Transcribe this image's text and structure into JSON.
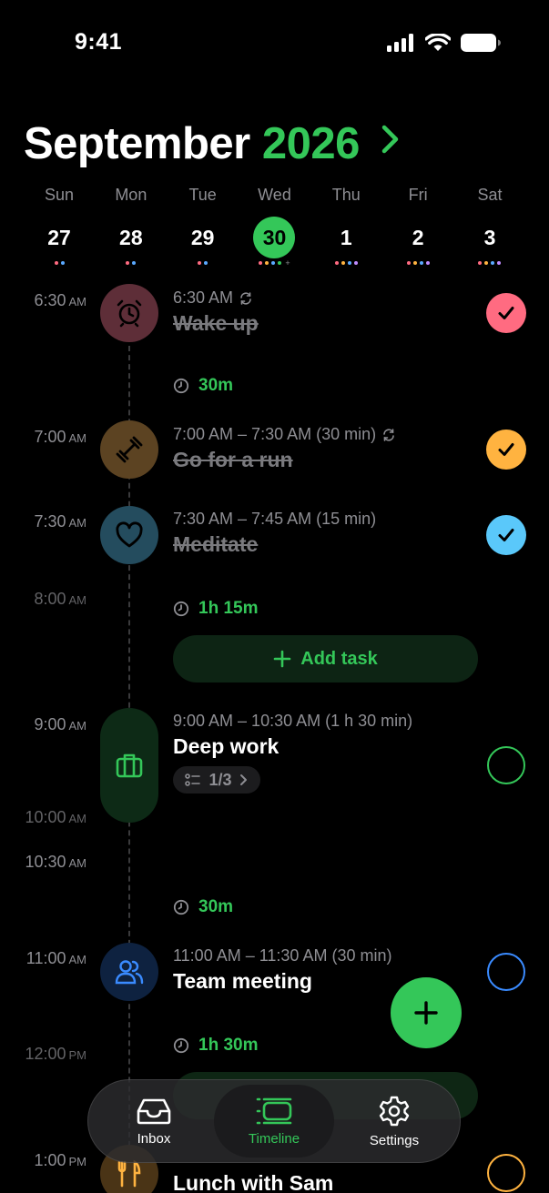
{
  "status_bar": {
    "time": "9:41"
  },
  "header": {
    "month": "September",
    "year": "2026"
  },
  "week": [
    {
      "dow": "Sun",
      "date": "27",
      "dots": [
        "#ff6b81",
        "#5aa9ff"
      ]
    },
    {
      "dow": "Mon",
      "date": "28",
      "dots": [
        "#ff6b81",
        "#5aa9ff"
      ]
    },
    {
      "dow": "Tue",
      "date": "29",
      "dots": [
        "#ff6b81",
        "#5aa9ff"
      ]
    },
    {
      "dow": "Wed",
      "date": "30",
      "selected": true,
      "dots": [
        "#ff6b81",
        "#ffb340",
        "#5aa9ff",
        "#34c759"
      ],
      "more": "+"
    },
    {
      "dow": "Thu",
      "date": "1",
      "dots": [
        "#ff6b81",
        "#ffb340",
        "#5aa9ff",
        "#bf8cff"
      ]
    },
    {
      "dow": "Fri",
      "date": "2",
      "dots": [
        "#ff6b81",
        "#ffb340",
        "#5aa9ff",
        "#bf8cff"
      ]
    },
    {
      "dow": "Sat",
      "date": "3",
      "dots": [
        "#ff6b81",
        "#ffb340",
        "#5aa9ff",
        "#bf8cff"
      ]
    }
  ],
  "time_labels": [
    {
      "time": "6:30",
      "ampm": "AM"
    },
    {
      "time": "7:00",
      "ampm": "AM"
    },
    {
      "time": "7:30",
      "ampm": "AM"
    },
    {
      "time": "8:00",
      "ampm": "AM"
    },
    {
      "time": "9:00",
      "ampm": "AM"
    },
    {
      "time": "10:00",
      "ampm": "AM"
    },
    {
      "time": "10:30",
      "ampm": "AM"
    },
    {
      "time": "11:00",
      "ampm": "AM"
    },
    {
      "time": "12:00",
      "ampm": "PM"
    },
    {
      "time": "1:00",
      "ampm": "PM"
    }
  ],
  "tasks": [
    {
      "meta": "6:30 AM",
      "title": "Wake up",
      "icon": "alarm-clock-icon",
      "color": "#ff6b81",
      "done": true
    },
    {
      "meta": "7:00 AM – 7:30 AM (30 min)",
      "title": "Go for a run",
      "icon": "dumbbell-icon",
      "color": "#ffb340",
      "done": true
    },
    {
      "meta": "7:30 AM – 7:45 AM (15 min)",
      "title": "Meditate",
      "icon": "heart-icon",
      "color": "#5ac8fa",
      "done": true
    },
    {
      "meta": "9:00 AM – 10:30 AM (1 h 30 min)",
      "title": "Deep work",
      "icon": "briefcase-icon",
      "color": "#34c759",
      "done": false,
      "subtasks": "1/3"
    },
    {
      "meta": "11:00 AM – 11:30 AM (30 min)",
      "title": "Team meeting",
      "icon": "people-icon",
      "color": "#3a8bff",
      "done": false
    },
    {
      "meta": "",
      "title": "Lunch with Sam",
      "icon": "fork-knife-icon",
      "color": "#ffb340",
      "done": false
    }
  ],
  "gaps": [
    "30m",
    "1h 15m",
    "30m",
    "1h 30m"
  ],
  "add_task_label": "Add task",
  "tabbar": {
    "inbox": "Inbox",
    "timeline": "Timeline",
    "settings": "Settings"
  }
}
